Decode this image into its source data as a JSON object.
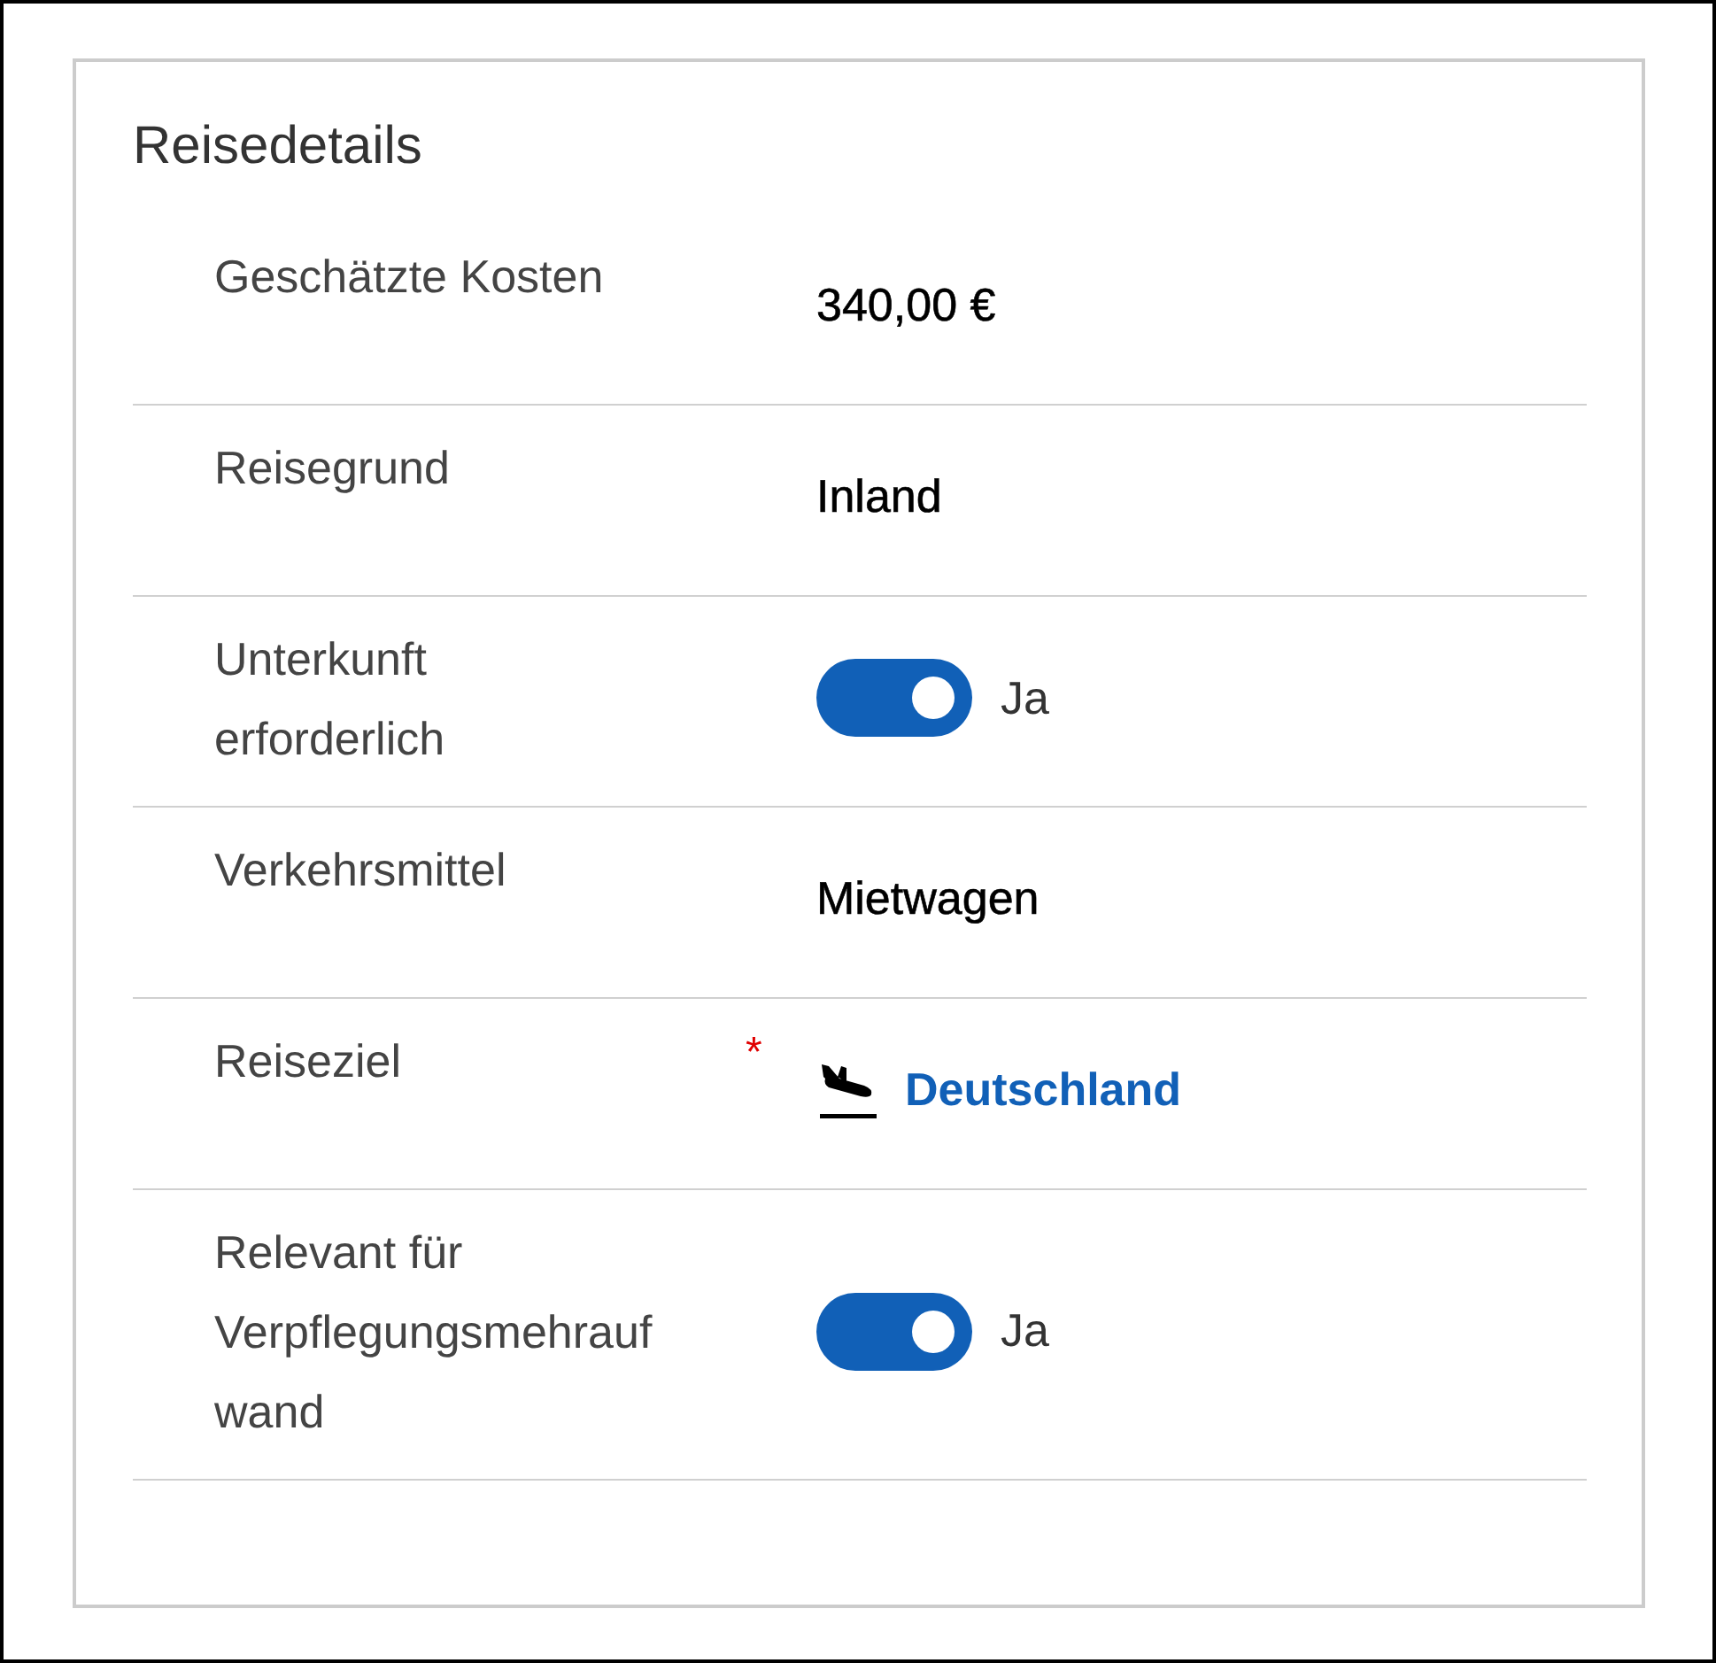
{
  "card": {
    "title": "Reisedetails"
  },
  "rows": [
    {
      "label": "Geschätzte Kosten",
      "required": false,
      "kind": "text",
      "value": "340,00 €"
    },
    {
      "label": "Reisegrund",
      "required": false,
      "kind": "text",
      "value": "Inland"
    },
    {
      "label": "Unterkunft erforderlich",
      "required": false,
      "kind": "toggle",
      "on": true,
      "value": "Ja"
    },
    {
      "label": "Verkehrsmittel",
      "required": false,
      "kind": "text",
      "value": "Mietwagen"
    },
    {
      "label": "Reiseziel",
      "required": true,
      "required_mark": "*",
      "kind": "link",
      "value": "Deutschland"
    },
    {
      "label": "Relevant für Verpflegungsmehraufwand",
      "required": false,
      "kind": "toggle",
      "on": true,
      "value": "Ja"
    }
  ]
}
